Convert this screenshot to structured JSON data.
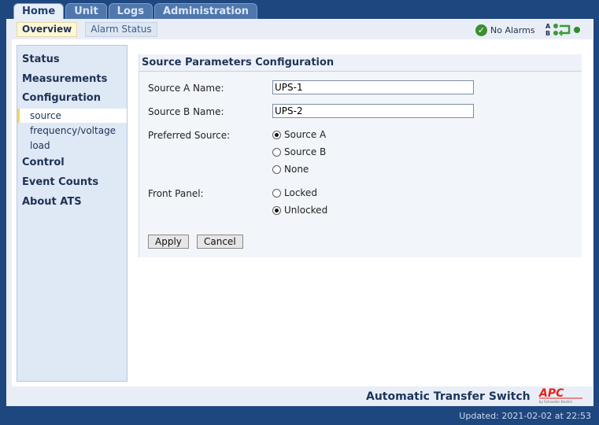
{
  "top_tabs": [
    {
      "label": "Home",
      "active": true
    },
    {
      "label": "Unit",
      "active": false
    },
    {
      "label": "Logs",
      "active": false
    },
    {
      "label": "Administration",
      "active": false
    }
  ],
  "sub_tabs": [
    {
      "label": "Overview",
      "active": true
    },
    {
      "label": "Alarm Status",
      "active": false
    }
  ],
  "alarm_status": {
    "label": "No Alarms",
    "icon": "check-circle-icon",
    "color": "#3a8f2f"
  },
  "ats_icon": {
    "top_letter": "A",
    "bottom_letter": "B"
  },
  "sidebar": {
    "status": "Status",
    "measurements": "Measurements",
    "configuration": "Configuration",
    "config_items": [
      "source",
      "frequency/voltage",
      "load"
    ],
    "selected_item": "source",
    "control": "Control",
    "event_counts": "Event Counts",
    "about": "About ATS"
  },
  "form": {
    "title": "Source Parameters Configuration",
    "source_a_label": "Source A Name:",
    "source_a_value": "UPS-1",
    "source_b_label": "Source B Name:",
    "source_b_value": "UPS-2",
    "preferred_label": "Preferred Source:",
    "preferred_options": [
      "Source A",
      "Source B",
      "None"
    ],
    "preferred_selected": "Source A",
    "front_panel_label": "Front Panel:",
    "front_panel_options": [
      "Locked",
      "Unlocked"
    ],
    "front_panel_selected": "Unlocked",
    "apply_label": "Apply",
    "cancel_label": "Cancel"
  },
  "footer": {
    "product_name": "Automatic Transfer Switch",
    "brand": "APC",
    "brand_sub": "by Schneider Electric",
    "brand_color": "#e2231a",
    "updated": "Updated: 2021-02-02 at 22:53"
  }
}
